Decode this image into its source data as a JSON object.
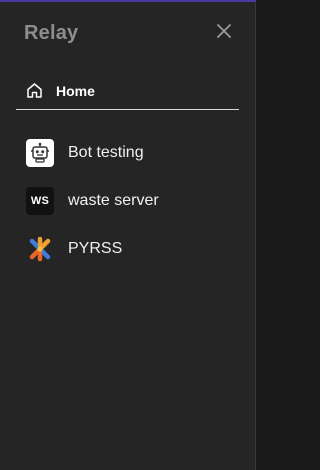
{
  "app": {
    "title": "Relay",
    "accent_color": "#4a3aa0",
    "panel_background": "#252525"
  },
  "header": {
    "close_icon": "close-icon"
  },
  "nav": {
    "home": {
      "label": "Home",
      "icon": "home-icon"
    }
  },
  "servers": [
    {
      "name": "Bot testing",
      "avatar": "robot-icon"
    },
    {
      "name": "waste server",
      "avatar_text": "WS"
    },
    {
      "name": "PYRSS",
      "avatar": "pyrss-logo"
    }
  ]
}
